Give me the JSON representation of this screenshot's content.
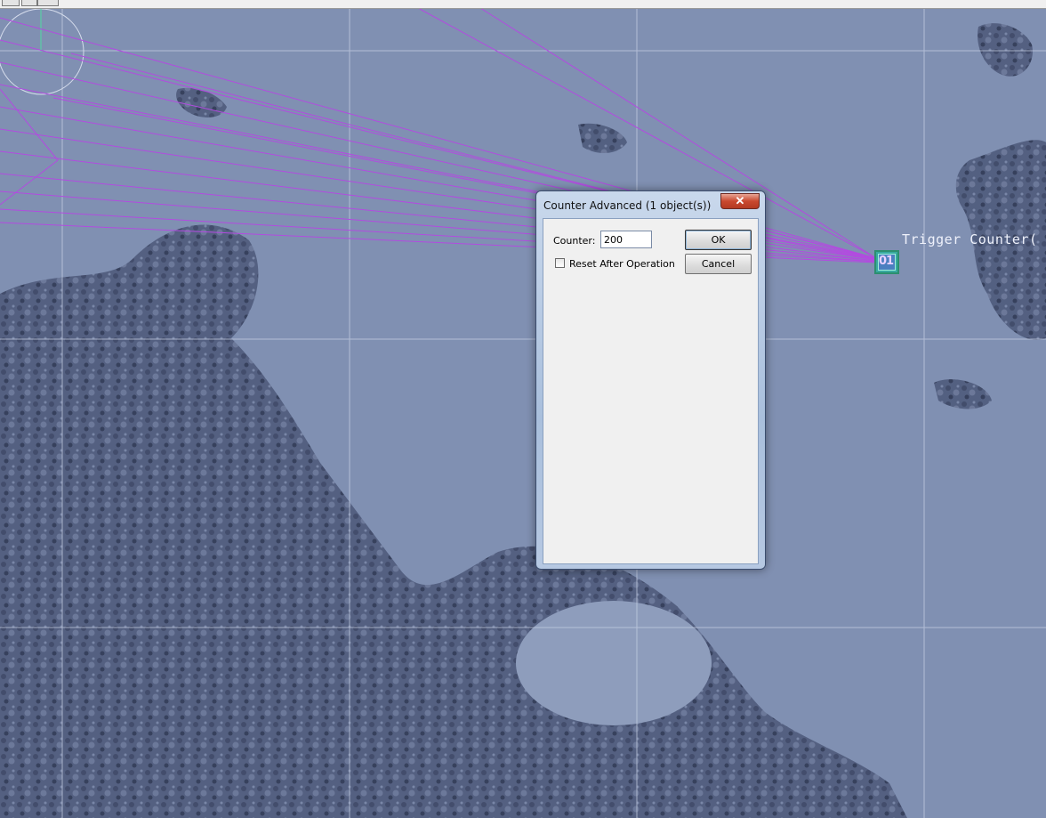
{
  "map": {
    "background_color": "#7f8fb0",
    "grid_color": "#c9d2e6",
    "trigger_line_color": "#b24be0",
    "trigger_label": "Trigger Counter(",
    "trigger_object_text": "01"
  },
  "dialog": {
    "title": "Counter Advanced (1 object(s))",
    "close_icon": "close-icon",
    "close_glyph": "✕",
    "counter_label": "Counter:",
    "counter_value": "200",
    "reset_label": "Reset After Operation",
    "reset_checked": false,
    "ok_label": "OK",
    "cancel_label": "Cancel"
  }
}
